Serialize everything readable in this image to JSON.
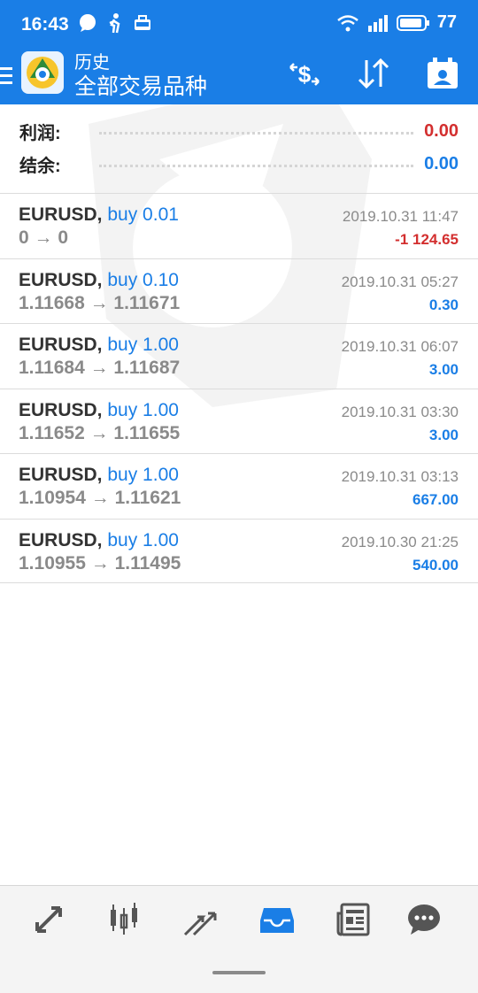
{
  "status_bar": {
    "time": "16:43",
    "battery": "77",
    "icons_left": [
      "chat-icon",
      "walking-icon",
      "briefcase-icon"
    ],
    "icons_right": [
      "wifi-icon",
      "signal-icon",
      "battery-icon"
    ]
  },
  "app_bar": {
    "subtitle": "历史",
    "title": "全部交易品种",
    "icons": [
      "deposit-withdraw-icon",
      "sort-icon",
      "calendar-icon"
    ]
  },
  "summary": {
    "profit_label": "利润:",
    "profit_value": "0.00",
    "balance_label": "结余:",
    "balance_value": "0.00"
  },
  "deals": [
    {
      "symbol": "EURUSD,",
      "side": "buy 0.01",
      "prices": "0 → 0",
      "time": "2019.10.31 11:47",
      "profit": "-1 124.65",
      "profit_color": "#d32f2f"
    },
    {
      "symbol": "EURUSD,",
      "side": "buy 0.10",
      "prices": "1.11668 → 1.11671",
      "time": "2019.10.31 05:27",
      "profit": "0.30",
      "profit_color": "#1a7ee6"
    },
    {
      "symbol": "EURUSD,",
      "side": "buy 1.00",
      "prices": "1.11684 → 1.11687",
      "time": "2019.10.31 06:07",
      "profit": "3.00",
      "profit_color": "#1a7ee6"
    },
    {
      "symbol": "EURUSD,",
      "side": "buy 1.00",
      "prices": "1.11652 → 1.11655",
      "time": "2019.10.31 03:30",
      "profit": "3.00",
      "profit_color": "#1a7ee6"
    },
    {
      "symbol": "EURUSD,",
      "side": "buy 1.00",
      "prices": "1.10954 → 1.11621",
      "time": "2019.10.31 03:13",
      "profit": "667.00",
      "profit_color": "#1a7ee6"
    },
    {
      "symbol": "EURUSD,",
      "side": "buy 1.00",
      "prices": "1.10955 → 1.11495",
      "time": "2019.10.30 21:25",
      "profit": "540.00",
      "profit_color": "#1a7ee6"
    }
  ],
  "bottom_nav": {
    "items": [
      "quotes-icon",
      "chart-icon",
      "trade-icon",
      "history-icon",
      "news-icon",
      "chat-icon"
    ],
    "active": "history-icon"
  },
  "colors": {
    "accent": "#1a7ee6",
    "loss": "#d32f2f",
    "muted": "#8a8a8a"
  }
}
